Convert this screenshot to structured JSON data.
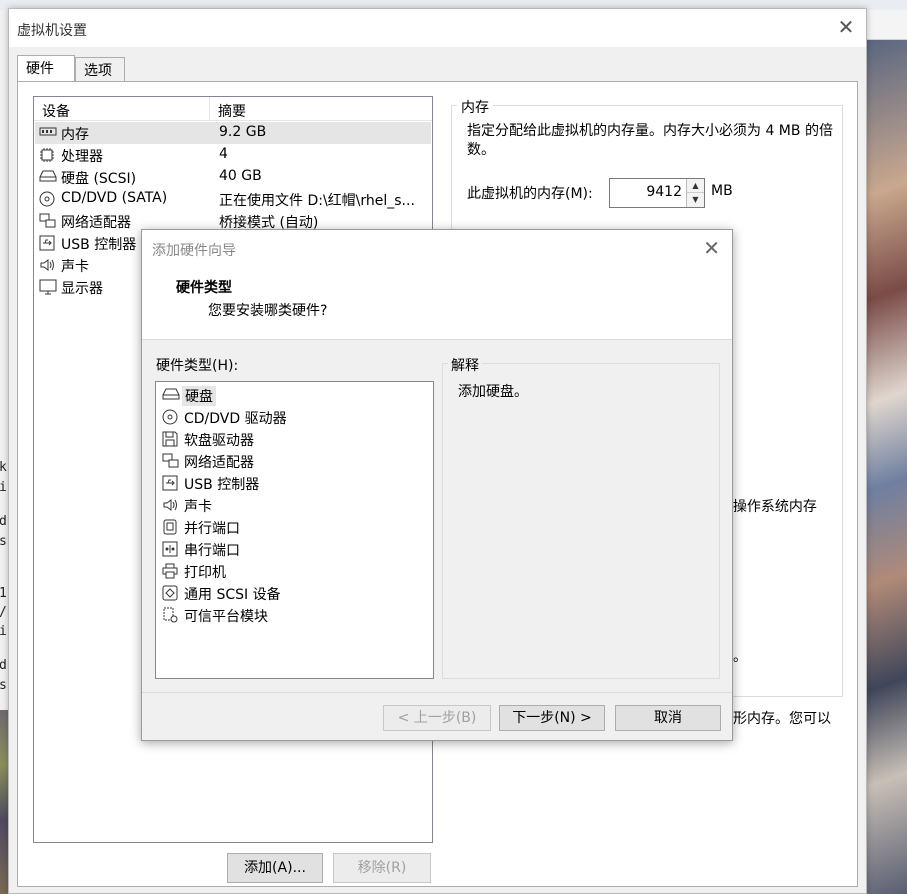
{
  "settings": {
    "title": "虚拟机设置",
    "tabs": [
      "硬件",
      "选项"
    ],
    "device_list": {
      "columns": [
        "设备",
        "摘要"
      ],
      "rows": [
        {
          "name": "内存",
          "summary": "9.2 GB",
          "icon": "memory-icon"
        },
        {
          "name": "处理器",
          "summary": "4",
          "icon": "cpu-icon"
        },
        {
          "name": "硬盘 (SCSI)",
          "summary": "40 GB",
          "icon": "hard-disk-icon"
        },
        {
          "name": "CD/DVD (SATA)",
          "summary": "正在使用文件 D:\\红帽\\rhel_s...",
          "icon": "cd-dvd-icon"
        },
        {
          "name": "网络适配器",
          "summary": "桥接模式 (自动)",
          "icon": "network-adapter-icon"
        },
        {
          "name": "USB 控制器",
          "summary": "",
          "icon": "usb-icon"
        },
        {
          "name": "声卡",
          "summary": "",
          "icon": "sound-icon"
        },
        {
          "name": "显示器",
          "summary": "",
          "icon": "monitor-icon"
        }
      ]
    },
    "buttons": {
      "add": "添加(A)...",
      "remove": "移除(R)"
    },
    "memory": {
      "legend": "内存",
      "description": "指定分配给此虚拟机的内存量。内存大小必须为 4 MB 的倍数。",
      "label": "此虚拟机的内存(M):",
      "value": "9412",
      "unit": "MB",
      "partial_text_1": "l操作系统内存",
      "partial_text_2": "。",
      "partial_text_3": "形内存。您可以"
    }
  },
  "wizard": {
    "title": "添加硬件向导",
    "heading": "硬件类型",
    "subheading": "您要安装哪类硬件?",
    "list_label": "硬件类型(H):",
    "items": [
      {
        "label": "硬盘",
        "icon": "hard-disk-icon"
      },
      {
        "label": "CD/DVD 驱动器",
        "icon": "cd-dvd-icon"
      },
      {
        "label": "软盘驱动器",
        "icon": "floppy-icon"
      },
      {
        "label": "网络适配器",
        "icon": "network-adapter-icon"
      },
      {
        "label": "USB 控制器",
        "icon": "usb-icon"
      },
      {
        "label": "声卡",
        "icon": "sound-icon"
      },
      {
        "label": "并行端口",
        "icon": "parallel-port-icon"
      },
      {
        "label": "串行端口",
        "icon": "serial-port-icon"
      },
      {
        "label": "打印机",
        "icon": "printer-icon"
      },
      {
        "label": "通用 SCSI 设备",
        "icon": "scsi-icon"
      },
      {
        "label": "可信平台模块",
        "icon": "tpm-icon"
      }
    ],
    "explanation_legend": "解释",
    "explanation_text": "添加硬盘。",
    "buttons": {
      "back": "< 上一步(B)",
      "next": "下一步(N) >",
      "cancel": "取消"
    }
  },
  "background_chars": [
    "k",
    "i",
    "d",
    "s",
    "1",
    "/",
    "i",
    "d",
    "s"
  ]
}
